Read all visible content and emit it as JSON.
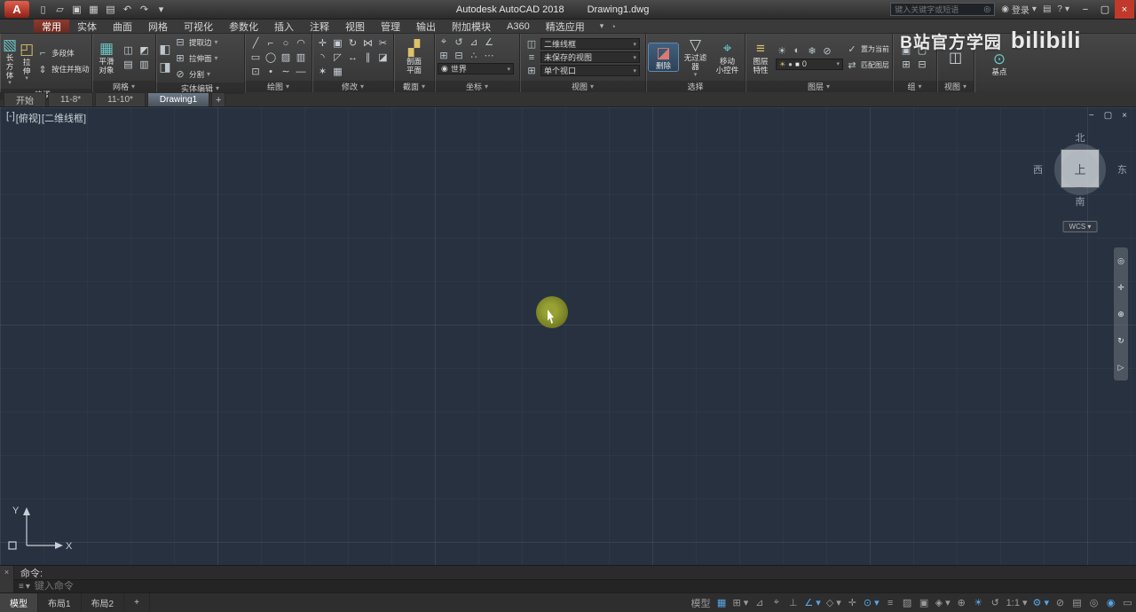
{
  "glyphs": {
    "caret": "▾",
    "minimize": "−",
    "maximize": "▢",
    "close": "×",
    "plus": "+"
  },
  "titlebar": {
    "logo_letter": "A",
    "app_title": "Autodesk AutoCAD 2018",
    "doc_title": "Drawing1.dwg",
    "qat_icons": [
      {
        "name": "new-file-icon",
        "glyph": "▯"
      },
      {
        "name": "open-file-icon",
        "glyph": "▱"
      },
      {
        "name": "save-icon",
        "glyph": "▣"
      },
      {
        "name": "save-as-icon",
        "glyph": "▦"
      },
      {
        "name": "plot-icon",
        "glyph": "▤"
      },
      {
        "name": "undo-icon",
        "glyph": "↶"
      },
      {
        "name": "redo-icon",
        "glyph": "↷"
      },
      {
        "name": "qat-overflow-icon",
        "glyph": "▾"
      }
    ],
    "search_placeholder": "键入关键字或短语",
    "search_icon_glyph": "◎",
    "signin_icon_glyph": "◉",
    "signin_label": "登录",
    "store_icon_glyph": "▤",
    "help_icon_glyph": "?",
    "window": {
      "minimize": "−",
      "maximize": "▢",
      "close": "×"
    }
  },
  "ribbon": {
    "tabs": [
      {
        "label": "常用",
        "active": true
      },
      {
        "label": "实体"
      },
      {
        "label": "曲面"
      },
      {
        "label": "网格"
      },
      {
        "label": "可视化"
      },
      {
        "label": "参数化"
      },
      {
        "label": "插入"
      },
      {
        "label": "注释"
      },
      {
        "label": "视图"
      },
      {
        "label": "管理"
      },
      {
        "label": "输出"
      },
      {
        "label": "附加模块"
      },
      {
        "label": "A360"
      },
      {
        "label": "精选应用"
      }
    ],
    "overflow_glyph": "▾",
    "toggle_glyph": "◔",
    "panels": {
      "modeling": {
        "label": "建模",
        "box_label": "长方体",
        "box_icon": "▧",
        "extrude_label": "拉伸",
        "extrude_icon": "◰",
        "polysolid_label": "多段体",
        "polysolid_icon": "⌐",
        "presspull_label": "按住并拖动",
        "presspull_icon": "⇕"
      },
      "mesh": {
        "label": "网格",
        "smooth_line1": "平滑",
        "smooth_line2": "对象",
        "smooth_icon": "▦",
        "icons": [
          {
            "name": "mesh-smooth-more-icon",
            "glyph": "◫"
          },
          {
            "name": "mesh-smooth-less-icon",
            "glyph": "◩"
          },
          {
            "name": "mesh-refine-icon",
            "glyph": "▤"
          },
          {
            "name": "mesh-crease-icon",
            "glyph": "▥"
          }
        ]
      },
      "solid_editing": {
        "label": "实体编辑",
        "union_icon": "◧",
        "subtract_icon": "◨",
        "rows": [
          {
            "name": "extract-edges-row",
            "icon": "⊟",
            "label": "提取边"
          },
          {
            "name": "extrude-faces-row",
            "icon": "⊞",
            "label": "拉伸面"
          },
          {
            "name": "separate-row",
            "icon": "⊘",
            "label": "分割"
          }
        ]
      },
      "draw": {
        "label": "绘图",
        "icons": [
          {
            "name": "line-icon",
            "glyph": "╱"
          },
          {
            "name": "polyline-icon",
            "glyph": "⌐"
          },
          {
            "name": "circle-icon",
            "glyph": "○"
          },
          {
            "name": "arc-icon",
            "glyph": "◠"
          },
          {
            "name": "rectangle-icon",
            "glyph": "▭"
          },
          {
            "name": "ellipse-icon",
            "glyph": "◯"
          },
          {
            "name": "hatch-icon",
            "glyph": "▨"
          },
          {
            "name": "gradient-icon",
            "glyph": "▥"
          },
          {
            "name": "boundary-icon",
            "glyph": "⊡"
          },
          {
            "name": "point-icon",
            "glyph": "•"
          },
          {
            "name": "spline-icon",
            "glyph": "∼"
          },
          {
            "name": "construction-line-icon",
            "glyph": "—"
          }
        ]
      },
      "modify": {
        "label": "修改",
        "icons": [
          {
            "name": "move-icon",
            "glyph": "✛"
          },
          {
            "name": "copy-icon",
            "glyph": "▣"
          },
          {
            "name": "rotate-icon",
            "glyph": "↻"
          },
          {
            "name": "mirror-icon",
            "glyph": "⋈"
          },
          {
            "name": "trim-icon",
            "glyph": "✂"
          },
          {
            "name": "fillet-icon",
            "glyph": "◝"
          },
          {
            "name": "scale-icon",
            "glyph": "◸"
          },
          {
            "name": "stretch-icon",
            "glyph": "↔"
          },
          {
            "name": "offset-icon",
            "glyph": "∥"
          },
          {
            "name": "erase-icon",
            "glyph": "◪"
          },
          {
            "name": "explode-icon",
            "glyph": "✶"
          },
          {
            "name": "array-icon",
            "glyph": "▦"
          }
        ]
      },
      "section": {
        "label": "截面",
        "button_line1": "剖面",
        "button_line2": "平面",
        "button_icon": "▞"
      },
      "coordinates": {
        "label": "坐标",
        "icons_row1": [
          {
            "name": "ucs-icon",
            "glyph": "⌖"
          },
          {
            "name": "ucs-previous-icon",
            "glyph": "↺"
          },
          {
            "name": "ucs-face-icon",
            "glyph": "⊿"
          },
          {
            "name": "ucs-object-icon",
            "glyph": "∠"
          }
        ],
        "icons_row2": [
          {
            "name": "ucs-origin-icon",
            "glyph": "⊞"
          },
          {
            "name": "ucs-zaxis-icon",
            "glyph": "⊟"
          },
          {
            "name": "ucs-3point-icon",
            "glyph": "∴"
          },
          {
            "name": "ucs-named-icon",
            "glyph": "⋯"
          }
        ],
        "world_icon": "◉",
        "world_label": "世界"
      },
      "view_ctrl": {
        "label": "视图",
        "rows": [
          {
            "name": "visual-style-dropdown",
            "icon": "◫",
            "value": "二维线框"
          },
          {
            "name": "named-views-dropdown",
            "icon": "≡",
            "value": "未保存的视图"
          },
          {
            "name": "viewport-config-dropdown",
            "icon": "⊞",
            "value": "单个视口"
          }
        ]
      },
      "selection": {
        "label": "选择",
        "erase_label": "删除",
        "erase_icon": "◪",
        "filter_label": "无过滤器",
        "filter_icon": "▽",
        "gizmo_line1": "移动",
        "gizmo_line2": "小控件",
        "gizmo_icon": "⌖"
      },
      "layers": {
        "label": "图层",
        "props_line1": "图层",
        "props_line2": "特性",
        "props_icon": "≡",
        "tool_icons": [
          {
            "name": "layer-off-icon",
            "glyph": "☀"
          },
          {
            "name": "layer-isolate-icon",
            "glyph": "◐"
          },
          {
            "name": "layer-freeze-icon",
            "glyph": "❄"
          },
          {
            "name": "layer-lock-icon",
            "glyph": "⊘"
          }
        ],
        "dropdown": {
          "swatch1": "☀",
          "swatch2": "●",
          "swatch3": "■",
          "value": "0"
        },
        "set_current_icon": "✓",
        "set_current_label": "置为当前",
        "match_icon": "⇄",
        "match_label": "匹配图层"
      },
      "groups": {
        "label": "组",
        "icons": [
          {
            "name": "group-icon",
            "glyph": "▣"
          },
          {
            "name": "ungroup-icon",
            "glyph": "▢"
          },
          {
            "name": "group-edit-icon",
            "glyph": "⊞"
          },
          {
            "name": "group-select-icon",
            "glyph": "⊟"
          }
        ]
      },
      "views2": {
        "label": "视图",
        "icon": "◫"
      },
      "basepoint": {
        "label": "基点",
        "icon": "⊙"
      }
    }
  },
  "file_tabs": {
    "tabs": [
      {
        "label": "开始"
      },
      {
        "label": "11-8*"
      },
      {
        "label": "11-10*"
      },
      {
        "label": "Drawing1",
        "active": true
      }
    ],
    "new_button": "+"
  },
  "canvas": {
    "viewport_controls": {
      "menu": "[-]",
      "view": "[俯视]",
      "style": "[二维线框]"
    },
    "window_controls": {
      "minimize": "−",
      "restore": "▢",
      "close": "×"
    },
    "viewcube": {
      "north": "北",
      "south": "南",
      "west": "西",
      "east": "东",
      "top": "上",
      "wcs_label": "WCS ▾"
    },
    "navbar_icons": [
      {
        "name": "navigation-wheel-icon",
        "glyph": "◎"
      },
      {
        "name": "pan-icon",
        "glyph": "✛"
      },
      {
        "name": "zoom-icon",
        "glyph": "⊕"
      },
      {
        "name": "orbit-icon",
        "glyph": "↻"
      },
      {
        "name": "show-motion-icon",
        "glyph": "▷"
      }
    ],
    "axis_y": "Y",
    "axis_x": "X"
  },
  "command_line": {
    "close_glyph": "×",
    "history_line": "命令:",
    "customize_glyph": "≡",
    "customize_caret": "▾",
    "input_placeholder": "键入命令"
  },
  "status_bar": {
    "layout_tabs": [
      {
        "label": "模型",
        "active": true
      },
      {
        "label": "布局1"
      },
      {
        "label": "布局2"
      },
      {
        "label": "+"
      }
    ],
    "items": [
      {
        "name": "model-space-button",
        "glyph": "模型"
      },
      {
        "name": "grid-display-icon",
        "glyph": "▦",
        "on": true
      },
      {
        "name": "snap-mode-icon",
        "glyph": "⊞ ▾"
      },
      {
        "name": "infer-constraints-icon",
        "glyph": "⊿"
      },
      {
        "name": "dynamic-input-icon",
        "glyph": "⌖"
      },
      {
        "name": "ortho-mode-icon",
        "glyph": "⊥"
      },
      {
        "name": "polar-tracking-icon",
        "glyph": "∠ ▾",
        "on": true
      },
      {
        "name": "isometric-drafting-icon",
        "glyph": "◇ ▾"
      },
      {
        "name": "object-snap-tracking-icon",
        "glyph": "✛"
      },
      {
        "name": "object-snap-icon",
        "glyph": "⊙ ▾",
        "on": true
      },
      {
        "name": "lineweight-icon",
        "glyph": "≡"
      },
      {
        "name": "transparency-icon",
        "glyph": "▨"
      },
      {
        "name": "selection-cycling-icon",
        "glyph": "▣"
      },
      {
        "name": "3d-object-snap-icon",
        "glyph": "◈ ▾"
      },
      {
        "name": "dynamic-ucs-icon",
        "glyph": "⊕"
      },
      {
        "name": "annotation-visibility-icon",
        "glyph": "☀",
        "on": true
      },
      {
        "name": "autoscale-icon",
        "glyph": "↺"
      },
      {
        "name": "annotation-scale-button",
        "glyph": "1:1 ▾"
      },
      {
        "name": "workspace-gear-icon",
        "glyph": "⚙ ▾",
        "on": true
      },
      {
        "name": "annotation-monitor-icon",
        "glyph": "⊘"
      },
      {
        "name": "quick-properties-icon",
        "glyph": "▤"
      },
      {
        "name": "isolate-objects-icon",
        "glyph": "◎"
      },
      {
        "name": "graphics-performance-icon",
        "glyph": "◉",
        "on": true
      },
      {
        "name": "clean-screen-icon",
        "glyph": "▭"
      }
    ]
  },
  "watermark": {
    "prefix": "B站官方学园",
    "logo": "bilibili"
  }
}
